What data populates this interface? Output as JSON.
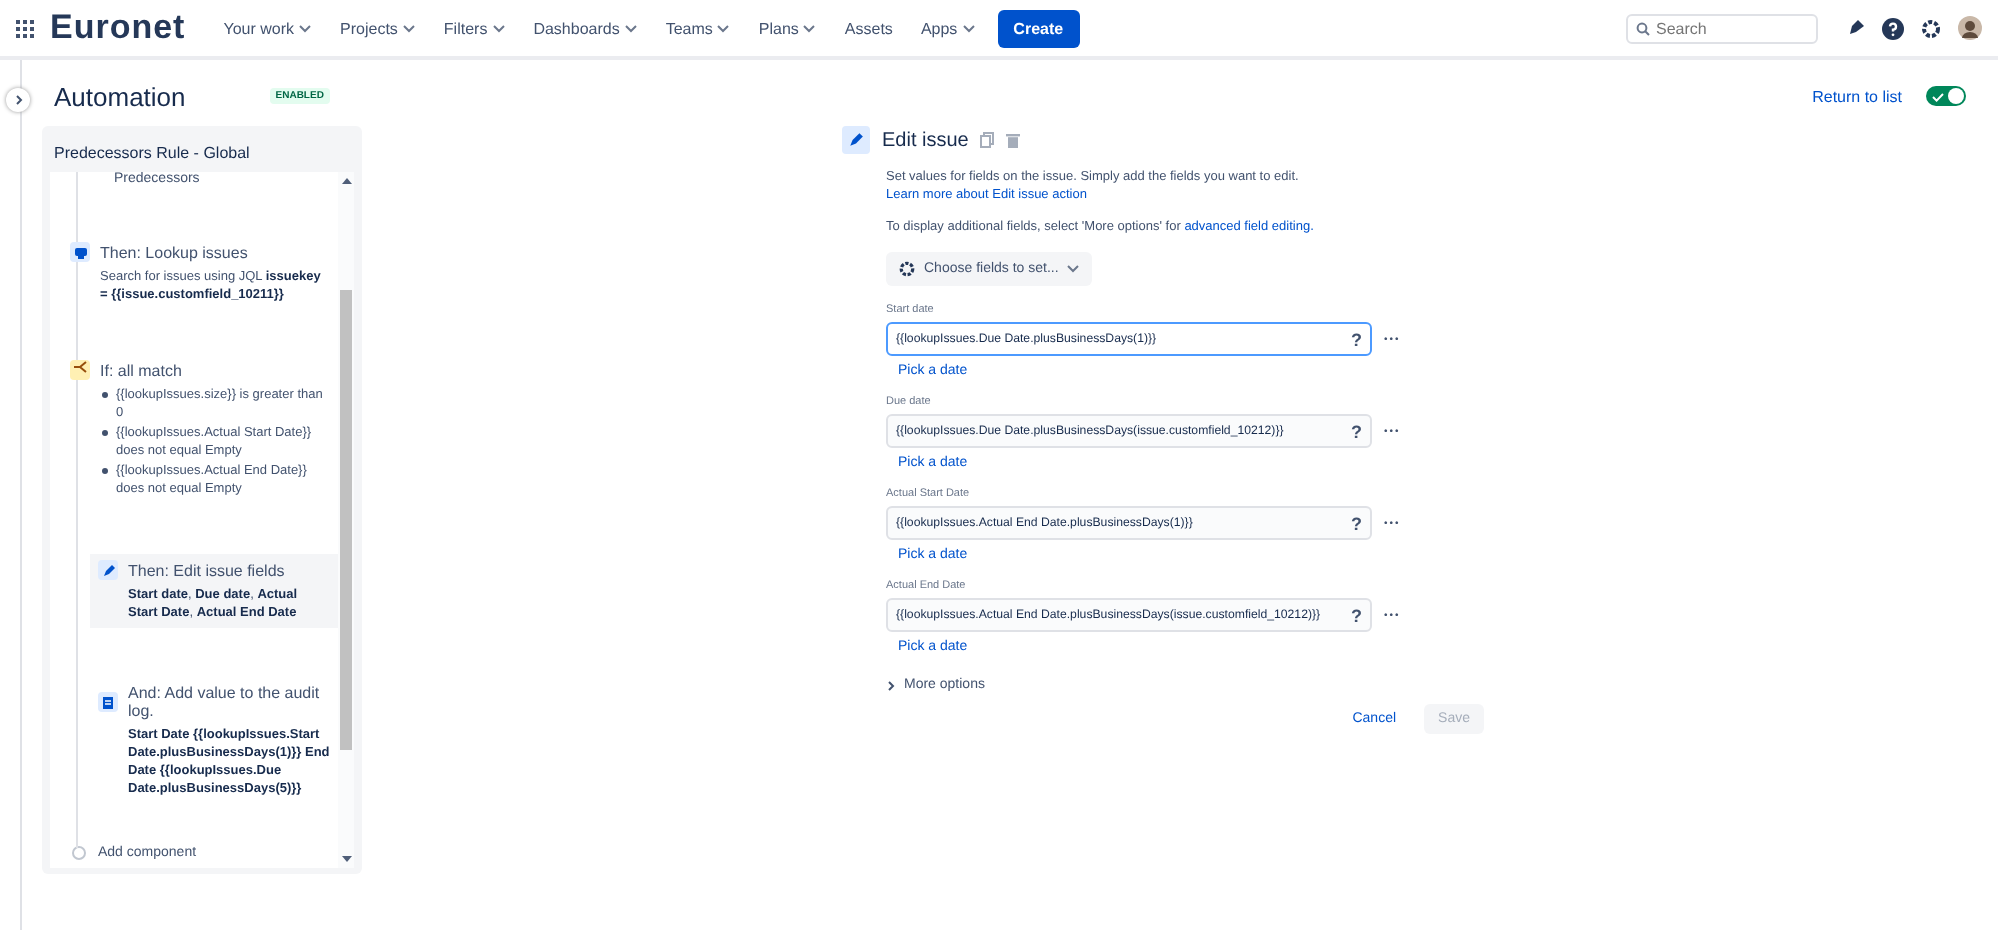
{
  "nav": {
    "logo": "Euronet",
    "items": [
      {
        "label": "Your work",
        "has_menu": true
      },
      {
        "label": "Projects",
        "has_menu": true
      },
      {
        "label": "Filters",
        "has_menu": true
      },
      {
        "label": "Dashboards",
        "has_menu": true
      },
      {
        "label": "Teams",
        "has_menu": true
      },
      {
        "label": "Plans",
        "has_menu": true
      },
      {
        "label": "Assets",
        "has_menu": false
      },
      {
        "label": "Apps",
        "has_menu": true
      }
    ],
    "create": "Create",
    "search": {
      "placeholder": "Search"
    }
  },
  "header": {
    "title": "Automation",
    "status": "ENABLED",
    "return_link": "Return to list",
    "enabled_toggle": {
      "on": true
    }
  },
  "rule": {
    "title": "Predecessors Rule - Global",
    "components": [
      {
        "kind": "text",
        "text": "Predecessors"
      },
      {
        "kind": "lookup",
        "heading": "Then: Lookup issues",
        "lines": [
          "Search for issues using JQL **issuekey = {{issue.customfield_10211}}**"
        ],
        "selected": false
      },
      {
        "kind": "condition",
        "heading": "If: all match",
        "lines": [
          "{{lookupIssues.size}} is greater than 0",
          "{{lookupIssues.Actual Start Date}} does not equal Empty",
          "{{lookupIssues.Actual End Date}} does not equal Empty"
        ],
        "selected": false
      },
      {
        "kind": "edit",
        "heading": "Then: Edit issue fields",
        "lines": [
          "**Start date**, **Due date**, **Actual Start Date**, **Actual End Date**"
        ],
        "selected": true
      },
      {
        "kind": "log",
        "heading": "And: Add value to the audit log.",
        "lines": [
          "**Start Date {{lookupIssues.Start Date.plusBusinessDays(1)}} End Date {{lookupIssues.Due Date.plusBusinessDays(5)}}**"
        ],
        "selected": false
      },
      {
        "kind": "add",
        "text": "Add component"
      }
    ]
  },
  "editor": {
    "title": "Edit issue",
    "description": "Set values for fields on the issue. Simply add the fields you want to edit.",
    "learn_link": "Learn more about Edit issue action",
    "hint": "To display additional fields, select 'More options' for",
    "hint_link": "advanced field editing.",
    "choose": "Choose fields to set...",
    "fields": [
      {
        "label": "Start date",
        "value": "{{lookupIssues.Due Date.plusBusinessDays(1)}}",
        "focused": true,
        "help": "?",
        "more": "•••",
        "pick": "Pick a date"
      },
      {
        "label": "Due date",
        "value": "{{lookupIssues.Due Date.plusBusinessDays(issue.customfield_10212)}}",
        "focused": false,
        "help": "?",
        "more": "•••",
        "pick": "Pick a date"
      },
      {
        "label": "Actual Start Date",
        "value": "{{lookupIssues.Actual End Date.plusBusinessDays(1)}}",
        "focused": false,
        "help": "?",
        "more": "•••",
        "pick": "Pick a date"
      },
      {
        "label": "Actual End Date",
        "value": "{{lookupIssues.Actual End Date.plusBusinessDays(issue.customfield_10212)}}",
        "focused": false,
        "help": "?",
        "more": "•••",
        "pick": "Pick a date"
      }
    ],
    "more_options": "More options",
    "cancel": "Cancel",
    "save": {
      "label": "Save",
      "disabled": true
    }
  }
}
